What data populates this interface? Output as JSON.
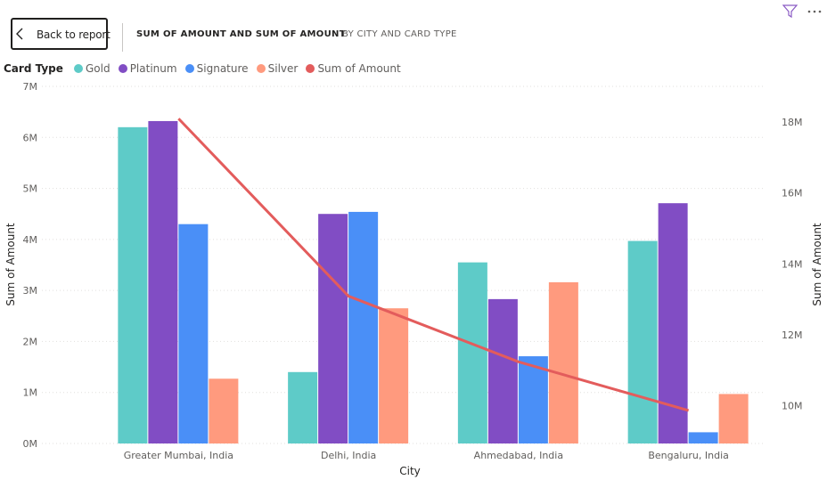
{
  "header": {
    "back_label": "Back to report",
    "title": "SUM OF AMOUNT AND SUM OF AMOUNT",
    "subtitle": "BY CITY AND CARD TYPE"
  },
  "icons": {
    "back": "chevron-left-icon",
    "filter": "filter-icon",
    "more": "more-options-icon"
  },
  "legend": {
    "title": "Card Type",
    "items": [
      {
        "label": "Gold",
        "color": "#5ECBC8"
      },
      {
        "label": "Platinum",
        "color": "#814DC4"
      },
      {
        "label": "Signature",
        "color": "#4A8FF7"
      },
      {
        "label": "Silver",
        "color": "#FF9A7E"
      },
      {
        "label": "Sum of Amount",
        "color": "#E35C5C"
      }
    ]
  },
  "chart_data": {
    "type": "bar",
    "categories": [
      "Greater Mumbai, India",
      "Delhi, India",
      "Ahmedabad, India",
      "Bengaluru, India"
    ],
    "series": [
      {
        "name": "Gold",
        "values": [
          6200000,
          1400000,
          3550000,
          3970000
        ]
      },
      {
        "name": "Platinum",
        "values": [
          6320000,
          4500000,
          2830000,
          4710000
        ]
      },
      {
        "name": "Signature",
        "values": [
          4300000,
          4540000,
          1710000,
          220000
        ]
      },
      {
        "name": "Silver",
        "values": [
          1270000,
          2650000,
          3160000,
          970000
        ]
      }
    ],
    "line_series": {
      "name": "Sum of Amount",
      "axis": "right",
      "values": [
        18090000,
        13090000,
        11240000,
        9870000
      ]
    },
    "xlabel": "City",
    "ylabel": "Sum of Amount",
    "y2label": "Sum of Amount",
    "ylim": [
      0,
      7000000
    ],
    "y2lim": [
      8940000,
      19000000
    ],
    "yticks": [
      "0M",
      "1M",
      "2M",
      "3M",
      "4M",
      "5M",
      "6M",
      "7M"
    ],
    "y2ticks": [
      "10M",
      "12M",
      "14M",
      "16M",
      "18M"
    ],
    "y2tick_values": [
      10000000,
      12000000,
      14000000,
      16000000,
      18000000
    ],
    "grid": true,
    "legend_position": "top-left"
  }
}
